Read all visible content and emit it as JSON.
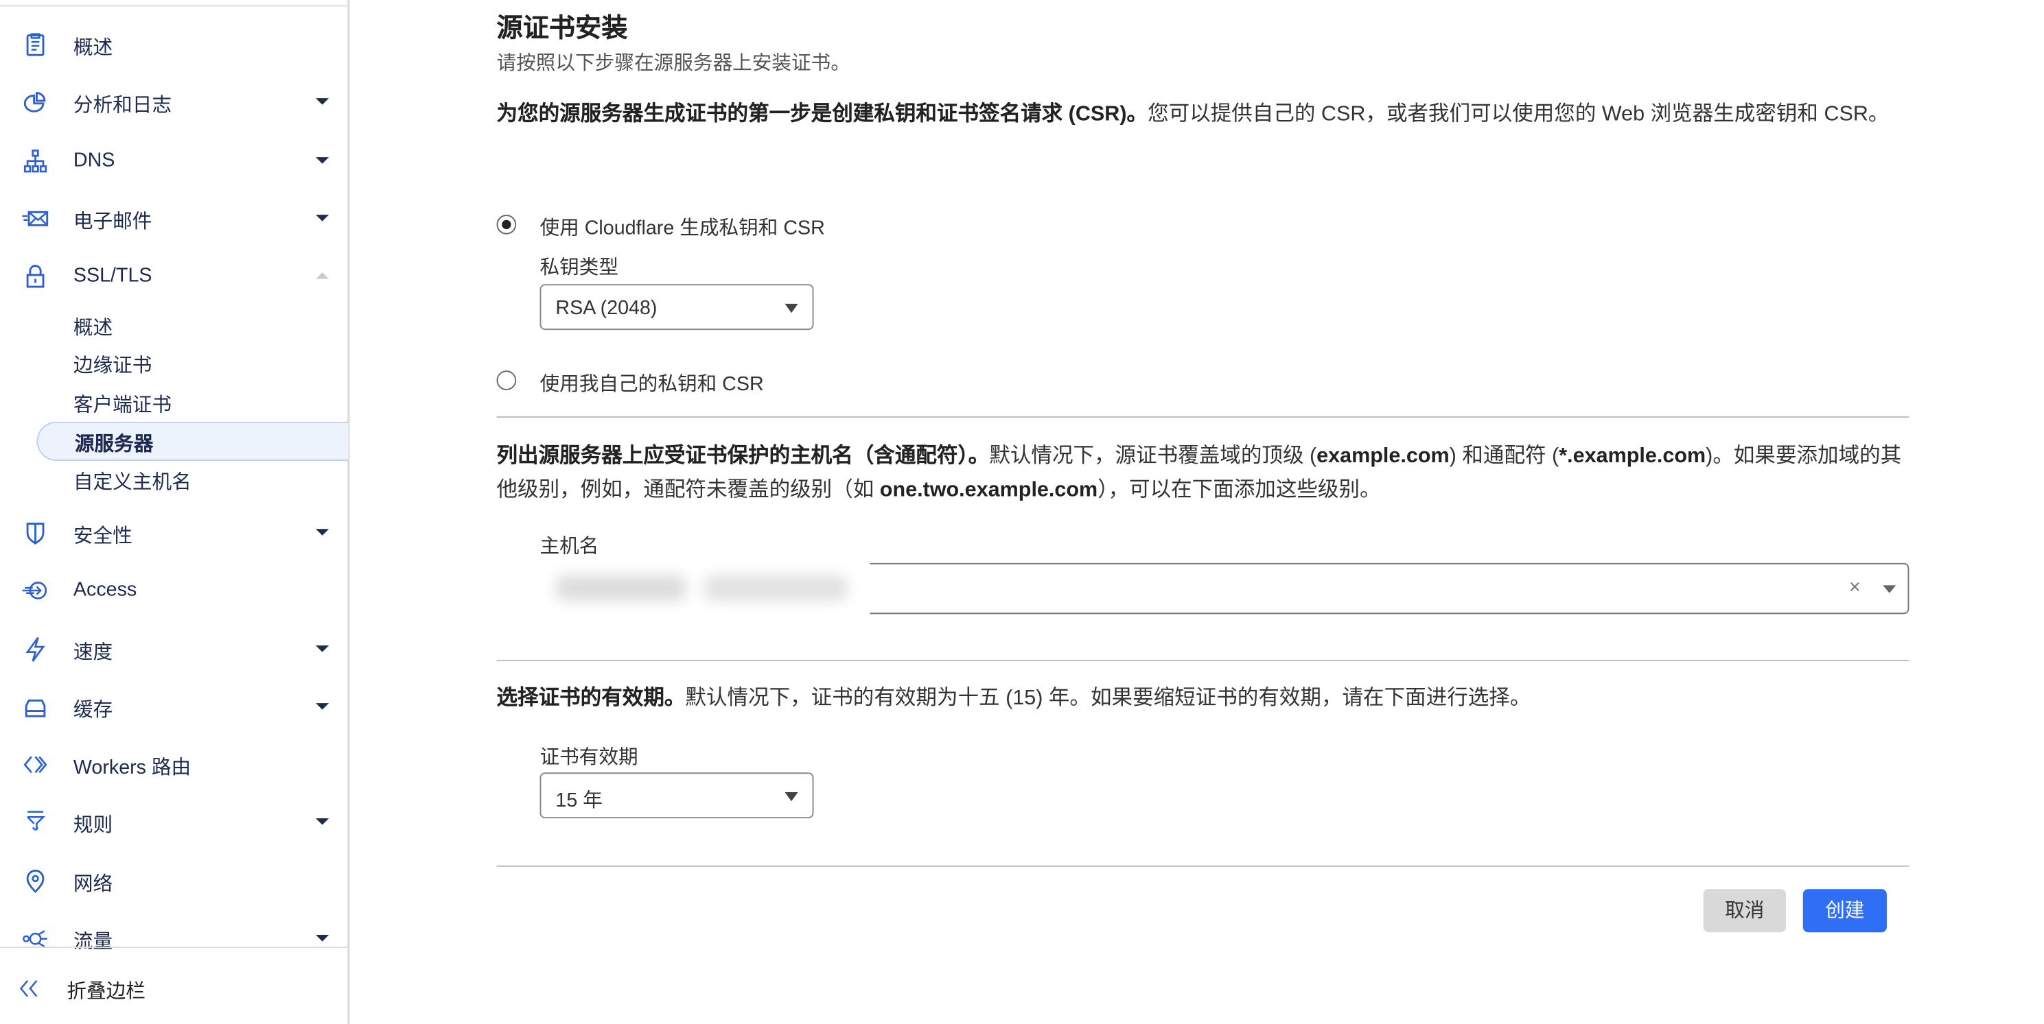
{
  "sidebar": {
    "items": [
      {
        "label": "概述",
        "icon": "clipboard-icon",
        "caret": false
      },
      {
        "label": "分析和日志",
        "icon": "pie-chart-icon",
        "caret": "down"
      },
      {
        "label": "DNS",
        "icon": "sitemap-icon",
        "caret": "down"
      },
      {
        "label": "电子邮件",
        "icon": "envelope-icon",
        "caret": "down"
      },
      {
        "label": "SSL/TLS",
        "icon": "lock-icon",
        "caret": "up"
      },
      {
        "label": "安全性",
        "icon": "shield-icon",
        "caret": "down"
      },
      {
        "label": "Access",
        "icon": "access-icon",
        "caret": false
      },
      {
        "label": "速度",
        "icon": "bolt-icon",
        "caret": "down"
      },
      {
        "label": "缓存",
        "icon": "storage-icon",
        "caret": "down"
      },
      {
        "label": "Workers 路由",
        "icon": "workers-icon",
        "caret": false
      },
      {
        "label": "规则",
        "icon": "funnel-icon",
        "caret": "down"
      },
      {
        "label": "网络",
        "icon": "location-pin-icon",
        "caret": false
      },
      {
        "label": "流量",
        "icon": "traffic-icon",
        "caret": "down"
      }
    ],
    "ssl_subitems": [
      {
        "label": "概述",
        "active": false
      },
      {
        "label": "边缘证书",
        "active": false
      },
      {
        "label": "客户端证书",
        "active": false
      },
      {
        "label": "源服务器",
        "active": true
      },
      {
        "label": "自定义主机名",
        "active": false
      }
    ],
    "collapse_label": "折叠边栏",
    "accent_color": "#2c5fd1"
  },
  "main": {
    "title": "源证书安装",
    "subtitle": "请按照以下步骤在源服务器上安装证书。",
    "step1": {
      "bold": "为您的源服务器生成证书的第一步是创建私钥和证书签名请求 (CSR)。",
      "text": "您可以提供自己的 CSR，或者我们可以使用您的 Web 浏览器生成密钥和 CSR。",
      "radio_generate": "使用 Cloudflare 生成私钥和 CSR",
      "radio_own": "使用我自己的私钥和 CSR",
      "selected": "generate",
      "key_type_label": "私钥类型",
      "key_type_value": "RSA (2048)"
    },
    "step2": {
      "bold1": "列出源服务器上应受证书保护的主机名（含通配符）。",
      "t1": "默认情况下，源证书覆盖域的顶级 (",
      "b2": "example.com",
      "t2": ") 和通配符 (",
      "b3": "*.example.com",
      "t3": ")。如果要添加域的其他级别，例如，通配符未覆盖的级别（如 ",
      "b4": "one.two.example.com",
      "t4": "），可以在下面添加这些级别。",
      "hostname_label": "主机名"
    },
    "step3": {
      "bold": "选择证书的有效期。",
      "text": "默认情况下，证书的有效期为十五 (15) 年。如果要缩短证书的有效期，请在下面进行选择。",
      "validity_label": "证书有效期",
      "validity_value": "15 年"
    },
    "cancel_label": "取消",
    "create_label": "创建",
    "primary_color": "#316ef6"
  }
}
